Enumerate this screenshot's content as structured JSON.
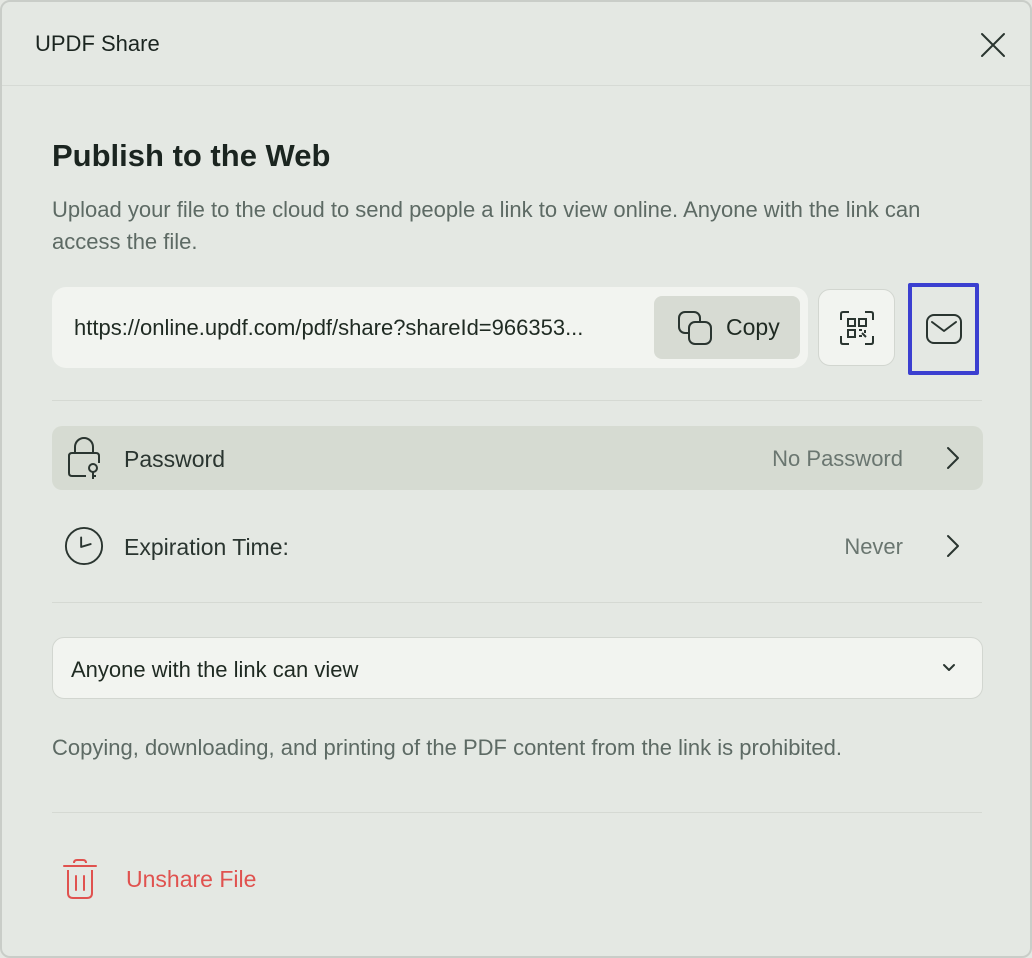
{
  "window": {
    "title": "UPDF Share"
  },
  "header": {
    "heading": "Publish to the Web",
    "description": "Upload your file to the cloud to send people a link to view online. Anyone with the link can access the file."
  },
  "share_link": {
    "url": "https://online.updf.com/pdf/share?shareId=966353...",
    "copy_label": "Copy",
    "copy_icon": "copy-icon",
    "qr_icon": "qr-code-icon",
    "mail_icon": "mail-icon"
  },
  "settings": {
    "password": {
      "label": "Password",
      "value": "No Password",
      "icon": "lock-icon"
    },
    "expiration": {
      "label": "Expiration Time:",
      "value": "Never",
      "icon": "clock-icon"
    }
  },
  "permission": {
    "selected": "Anyone with the link can view"
  },
  "note": "Copying, downloading, and printing of the PDF content from the link is prohibited.",
  "unshare": {
    "label": "Unshare File",
    "icon": "trash-icon"
  },
  "colors": {
    "background": "#e4e8e3",
    "danger": "#e0524f",
    "highlight_frame": "#3b3fd0",
    "row_highlight": "#d6dbd2"
  }
}
